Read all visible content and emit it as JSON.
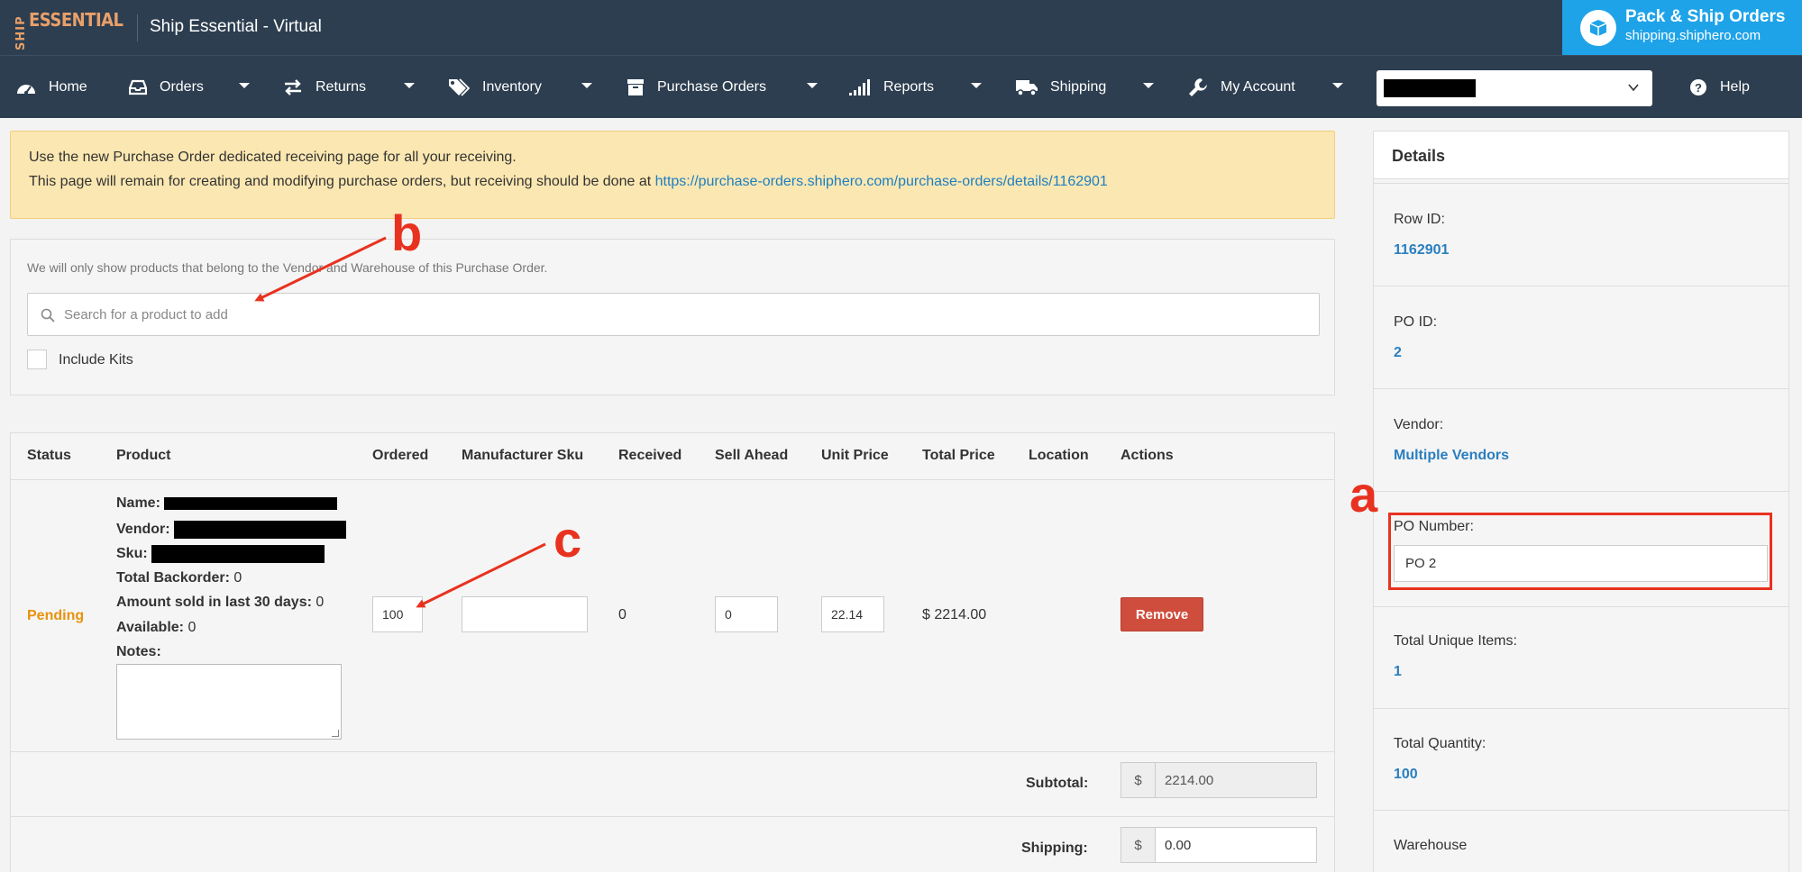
{
  "app": {
    "logo_vertical": "SHIP",
    "logo_main": "ESSENTIAL",
    "title": "Ship Essential - Virtual"
  },
  "promo": {
    "title": "Pack & Ship Orders",
    "url": "shipping.shiphero.com"
  },
  "nav": {
    "items": [
      {
        "label": "Home",
        "icon": "dashboard-icon"
      },
      {
        "label": "Orders",
        "icon": "inbox-icon"
      },
      {
        "label": "Returns",
        "icon": "exchange-icon"
      },
      {
        "label": "Inventory",
        "icon": "tags-icon"
      },
      {
        "label": "Purchase Orders",
        "icon": "archive-icon"
      },
      {
        "label": "Reports",
        "icon": "bar-signal-icon"
      },
      {
        "label": "Shipping",
        "icon": "truck-icon"
      },
      {
        "label": "My Account",
        "icon": "wrench-icon"
      }
    ],
    "help": "Help"
  },
  "alert": {
    "line1": "Use the new Purchase Order dedicated receiving page for all your receiving.",
    "line2": "This page will remain for creating and modifying purchase orders, but receiving should be done at ",
    "link": "https://purchase-orders.shiphero.com/purchase-orders/details/1162901"
  },
  "search": {
    "note": "We will only show products that belong to the Vendor and Warehouse of this Purchase Order.",
    "placeholder": "Search for a product to add",
    "include_kits": "Include Kits"
  },
  "table": {
    "headers": [
      "Status",
      "Product",
      "Ordered",
      "Manufacturer Sku",
      "Received",
      "Sell Ahead",
      "Unit Price",
      "Total Price",
      "Location",
      "Actions"
    ],
    "row": {
      "status": "Pending",
      "name_label": "Name:",
      "vendor_label": "Vendor:",
      "sku_label": "Sku:",
      "backorder_label": "Total Backorder:",
      "backorder_value": "0",
      "sold_label": "Amount sold in last 30 days:",
      "sold_value": "0",
      "available_label": "Available:",
      "available_value": "0",
      "notes_label": "Notes:",
      "ordered": "100",
      "manufacturer_sku": "",
      "received": "0",
      "sell_ahead": "0",
      "unit_price": "22.14",
      "total_price": "$ 2214.00",
      "remove": "Remove"
    },
    "subtotal_label": "Subtotal:",
    "subtotal_symbol": "$",
    "subtotal_value": "2214.00",
    "shipping_label": "Shipping:",
    "shipping_symbol": "$",
    "shipping_value": "0.00"
  },
  "details": {
    "title": "Details",
    "row_id_label": "Row ID:",
    "row_id": "1162901",
    "po_id_label": "PO ID:",
    "po_id": "2",
    "vendor_label": "Vendor:",
    "vendor": "Multiple Vendors",
    "po_number_label": "PO Number:",
    "po_number": "PO 2",
    "unique_items_label": "Total Unique Items:",
    "unique_items": "1",
    "quantity_label": "Total Quantity:",
    "quantity": "100",
    "warehouse_label": "Warehouse"
  },
  "annotations": {
    "a": "a",
    "b": "b",
    "c": "c",
    "color": "#e8321f"
  },
  "colors": {
    "nav_bg": "#2d3e50",
    "promo_bg": "#1fa3e8",
    "alert_bg": "#fbe7b1",
    "link": "#1d7fc2",
    "pending": "#e8920c",
    "remove_btn": "#cf4d3c",
    "detail_value": "#2a7fbf"
  }
}
